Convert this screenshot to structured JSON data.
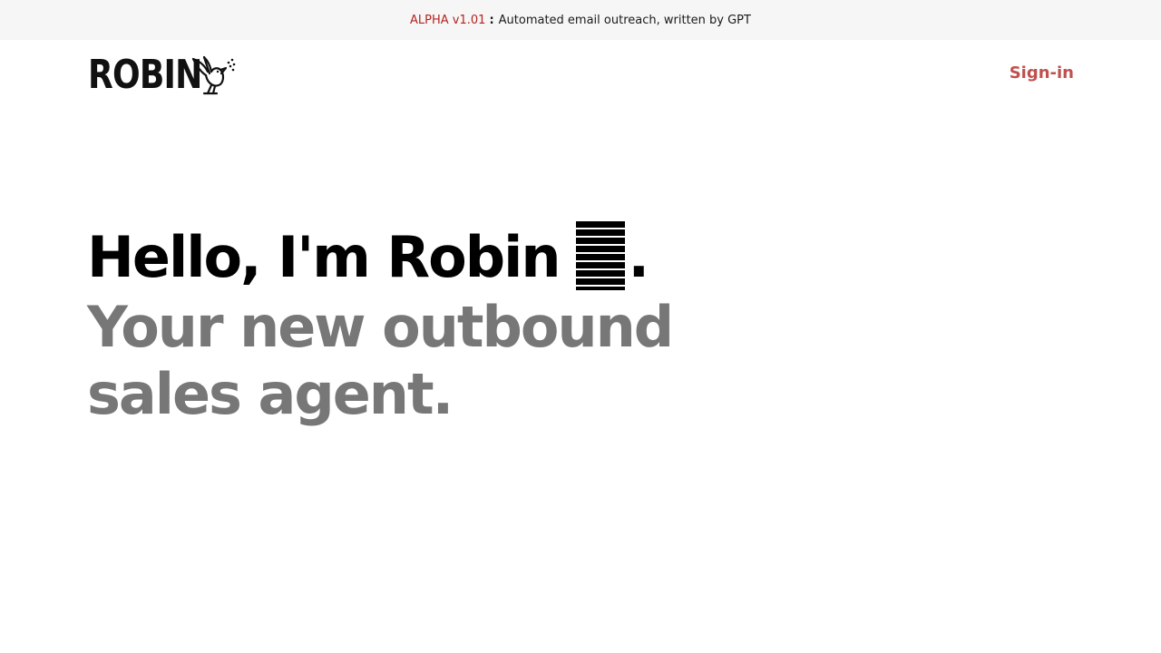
{
  "announcement": {
    "version": "ALPHA v1.01",
    "separator": ":",
    "text": "Automated email outreach, written by GPT"
  },
  "header": {
    "logo_text": "ROBIN",
    "logo_icon": "robin-bird-icon",
    "signin_label": "Sign-in"
  },
  "hero": {
    "headline": "Hello, I'm Robin",
    "headline_end": ".",
    "cursor_icon": "striped-cursor-block",
    "subheadline": "Your new outbound sales agent."
  },
  "colors": {
    "accent": "#c0504d",
    "version_red": "#b3241f",
    "heading": "#000000",
    "subheading": "#777777",
    "announce_bg": "#f6f6f6"
  }
}
